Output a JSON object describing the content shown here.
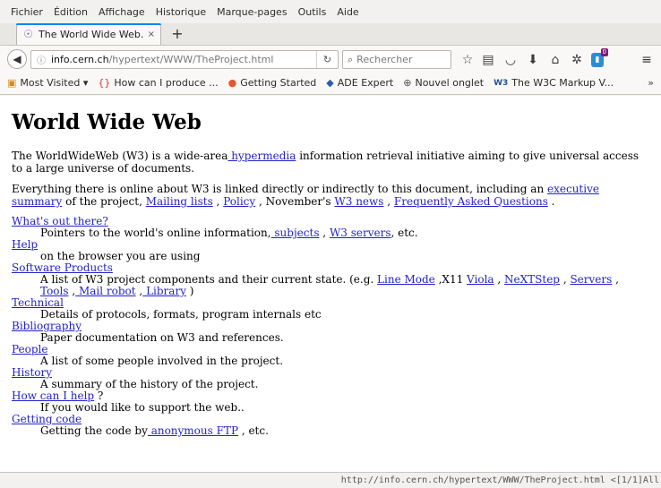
{
  "menu": [
    "Fichier",
    "Édition",
    "Affichage",
    "Historique",
    "Marque-pages",
    "Outils",
    "Aide"
  ],
  "tab": {
    "title": "The World Wide Web...",
    "close": "×",
    "new": "+"
  },
  "nav": {
    "url_host": "info.cern.ch",
    "url_path": "/hypertext/WWW/TheProject.html",
    "search_placeholder": "Rechercher"
  },
  "bookmarks": [
    {
      "icon": "folder-icon",
      "label": "Most Visited ▾"
    },
    {
      "icon": "code-braces-icon",
      "label": "How can I produce ..."
    },
    {
      "icon": "globe-icon",
      "label": "Getting Started"
    },
    {
      "icon": "ade-icon",
      "label": "ADE Expert"
    },
    {
      "icon": "globe-outline-icon",
      "label": "Nouvel onglet"
    },
    {
      "icon": "w3c-icon",
      "label": "The W3C Markup V..."
    }
  ],
  "toolbar": {
    "extension_badge": "0"
  },
  "page": {
    "title": "World Wide Web",
    "intro": {
      "before": "The WorldWideWeb (W3) is a wide-area",
      "link": " hypermedia",
      "after": " information retrieval initiative aiming to give universal access to a large universe of documents."
    },
    "para2": {
      "t1": "Everything there is online about W3 is linked directly or indirectly to this document, including an ",
      "l1": "executive summary",
      "t2": " of the project, ",
      "l2": "Mailing lists",
      "t3": " , ",
      "l3": "Policy",
      "t4": " , November's ",
      "l4": "W3 news",
      "t5": " , ",
      "l5": "Frequently Asked Questions",
      "t6": " ."
    },
    "items": {
      "out_there": {
        "term": "What's out there?",
        "d1": "Pointers to the world's online information,",
        "l1": " subjects",
        "d2": " , ",
        "l2": "W3 servers",
        "d3": ", etc."
      },
      "help": {
        "term": "Help",
        "desc": "on the browser you are using"
      },
      "software": {
        "term": "Software Products",
        "d1": "A list of W3 project components and their current state. (e.g. ",
        "l1": "Line Mode",
        "d2": " ,X11 ",
        "l2": "Viola",
        "d3": " , ",
        "l3": "NeXTStep",
        "d4": " , ",
        "l4": "Servers",
        "d5": " , ",
        "l5": "Tools",
        "d6": " ,",
        "l6": " Mail robot",
        "d7": " ,",
        "l7": " Library",
        "d8": " )"
      },
      "technical": {
        "term": "Technical",
        "desc": "Details of protocols, formats, program internals etc"
      },
      "bibliography": {
        "term": "Bibliography",
        "desc": "Paper documentation on W3 and references."
      },
      "people": {
        "term": "People",
        "desc": "A list of some people involved in the project."
      },
      "history": {
        "term": "History",
        "desc": "A summary of the history of the project."
      },
      "how_help": {
        "term": "How can I help",
        "suffix": " ?",
        "desc": "If you would like to support the web.."
      },
      "getting_code": {
        "term": "Getting code",
        "d1": "Getting the code by",
        "l1": " anonymous FTP",
        "d2": " , etc."
      }
    }
  },
  "status": "http://info.cern.ch/hypertext/WWW/TheProject.html <[1/1]All"
}
